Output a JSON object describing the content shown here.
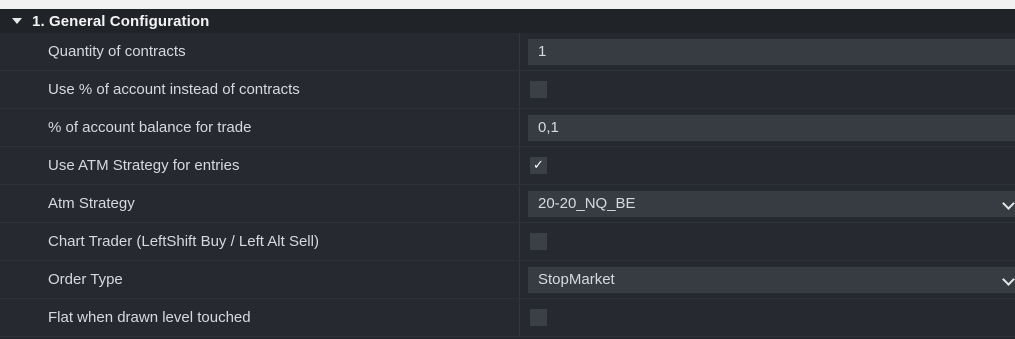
{
  "section": {
    "title": "1. General Configuration",
    "expanded_icon": "triangle-down-icon"
  },
  "settings": [
    {
      "label": "Quantity of contracts",
      "type": "number",
      "value": "1"
    },
    {
      "label": "Use % of account instead of contracts",
      "type": "checkbox",
      "checked": false
    },
    {
      "label": "% of account balance for trade",
      "type": "number",
      "value": "0,1"
    },
    {
      "label": "Use ATM Strategy for entries",
      "type": "checkbox",
      "checked": true,
      "check_glyph": "✓"
    },
    {
      "label": "Atm Strategy",
      "type": "select",
      "value": "20-20_NQ_BE"
    },
    {
      "label": "Chart Trader (LeftShift Buy / Left Alt Sell)",
      "type": "checkbox",
      "checked": false
    },
    {
      "label": "Order Type",
      "type": "select",
      "value": "StopMarket"
    },
    {
      "label": "Flat when drawn level touched",
      "type": "checkbox",
      "checked": false
    }
  ],
  "colors": {
    "background": "#262a30",
    "header_background": "#202328",
    "input_background": "#373c43",
    "checkbox_background": "#3b4047",
    "text": "#d6d9dd"
  }
}
